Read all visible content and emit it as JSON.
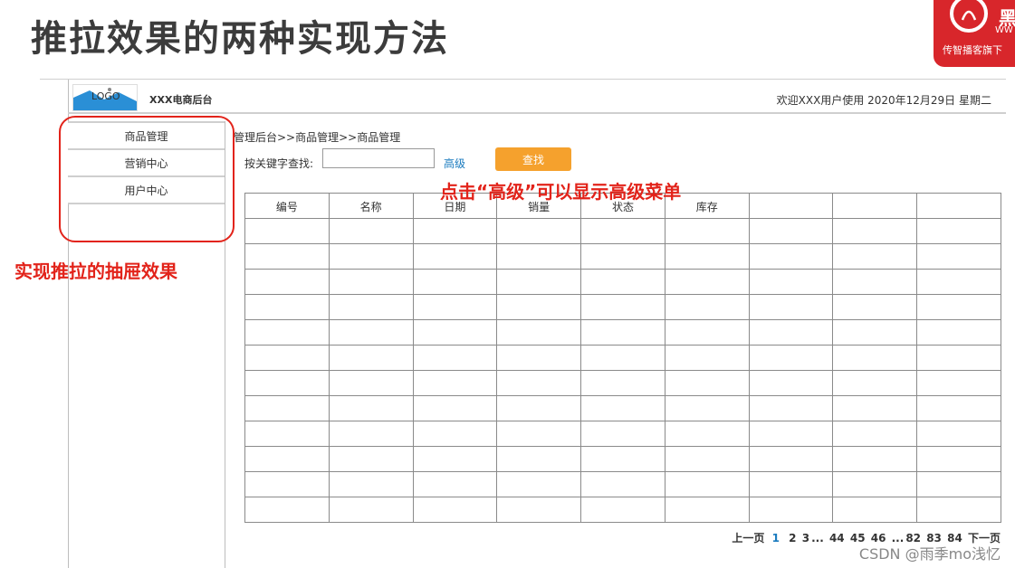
{
  "slide": {
    "title": "推拉效果的两种实现方法",
    "brand_name": "黑",
    "brand_sub": "WW",
    "brand_tag": "传智播客旗下"
  },
  "header": {
    "logo_text": "LOGO",
    "app_title": "XXX电商后台",
    "welcome": "欢迎XXX用户使用  2020年12月29日 星期二"
  },
  "sidebar": {
    "items": [
      {
        "label": "商品管理"
      },
      {
        "label": "营销中心"
      },
      {
        "label": "用户中心"
      }
    ]
  },
  "main": {
    "breadcrumb": "管理后台>>商品管理>>商品管理",
    "search_label": "按关键字查找:",
    "search_value": "",
    "advanced_label": "高级",
    "search_button": "查找",
    "table": {
      "columns": [
        "编号",
        "名称",
        "日期",
        "销量",
        "状态",
        "库存",
        "",
        "",
        ""
      ],
      "rows": 12
    },
    "pagination": {
      "prev": "上一页",
      "current": "1",
      "pages_a": [
        "2",
        "3"
      ],
      "ellipsis1": "...",
      "pages_b": [
        "44",
        "45",
        "46"
      ],
      "ellipsis2": "...",
      "pages_c": [
        "82",
        "83",
        "84"
      ],
      "next": "下一页"
    }
  },
  "annotations": {
    "left": "实现推拉的抽屉效果",
    "top": "点击“高级”可以显示高级菜单"
  },
  "watermark": "CSDN @雨季mo浅忆",
  "colors": {
    "accent_red": "#e2231a",
    "brand_red": "#d8262b",
    "button_orange": "#f5a12d",
    "link_blue": "#1a7bbf"
  }
}
